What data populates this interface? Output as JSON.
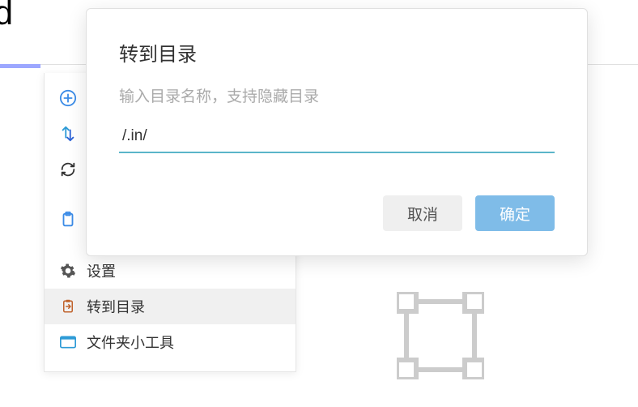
{
  "topbar": {
    "title_fragment": "oud"
  },
  "toolbar": {
    "icons": {
      "add": "add-circle-icon",
      "transfer": "transfer-icon",
      "refresh": "refresh-icon",
      "clipboard": "clipboard-icon"
    }
  },
  "menu": {
    "items": [
      {
        "icon": "gear-icon",
        "label": "设置",
        "active": false
      },
      {
        "icon": "clipboard-go-icon",
        "label": "转到目录",
        "active": true
      },
      {
        "icon": "widget-icon",
        "label": "文件夹小工具",
        "active": false
      }
    ]
  },
  "dialog": {
    "title": "转到目录",
    "hint": "输入目录名称，支持隐藏目录",
    "input_value": "/.in/",
    "cancel_label": "取消",
    "confirm_label": "确定"
  },
  "colors": {
    "accent_input": "#5BB5C9",
    "confirm_button": "#7FBCE8",
    "title_underline": "#9CA7FF"
  }
}
